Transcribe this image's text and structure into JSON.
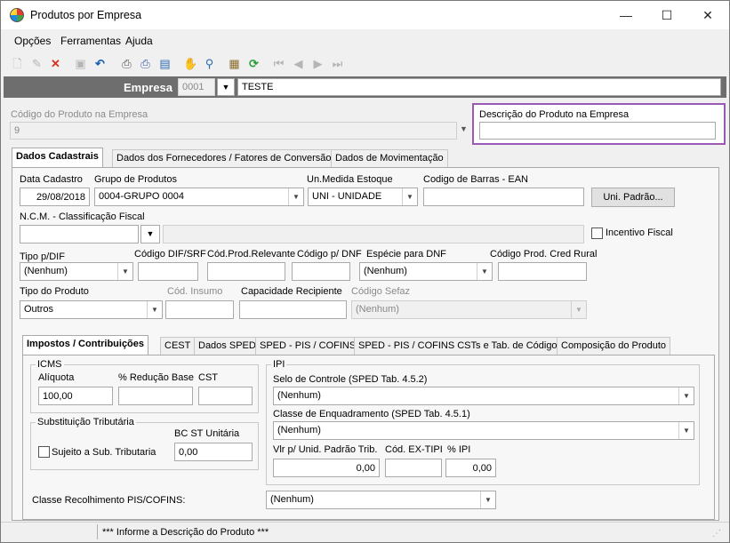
{
  "window": {
    "title": "Produtos por Empresa",
    "minimize": "—",
    "maximize": "☐",
    "close": "✕"
  },
  "menu": [
    "Opções",
    "Ferramentas",
    "Ajuda"
  ],
  "toolbar_icons": [
    "new-icon",
    "edit-icon",
    "delete-icon",
    "save-icon",
    "undo-icon",
    "print-icon",
    "print-preview-icon",
    "export-icon",
    "hand-icon",
    "search-icon",
    "report-icon",
    "refresh-icon",
    "first-record-icon",
    "prev-record-icon",
    "next-record-icon",
    "last-record-icon"
  ],
  "empresa": {
    "label": "Empresa",
    "code": "0001",
    "name": "TESTE"
  },
  "codigo_produto": {
    "label": "Código do Produto na Empresa",
    "value": "9"
  },
  "descricao_produto": {
    "label": "Descrição do Produto na Empresa",
    "value": ""
  },
  "main_tabs": [
    "Dados Cadastrais",
    "Dados dos Fornecedores / Fatores de Conversão",
    "Dados de Movimentação"
  ],
  "cadastro": {
    "data_cadastro_label": "Data Cadastro",
    "data_cadastro": "29/08/2018",
    "grupo_label": "Grupo de Produtos",
    "grupo": "0004-GRUPO 0004",
    "un_medida_label": "Un.Medida Estoque",
    "un_medida": "UNI - UNIDADE",
    "ean_label": "Codigo de Barras - EAN",
    "ean": "",
    "uni_padrao_btn": "Uni. Padrão...",
    "ncm_label": "N.C.M. -  Classificação Fiscal",
    "ncm": "",
    "ncm_desc": "",
    "incentivo_label": "Incentivo Fiscal",
    "tipo_dif_label": "Tipo p/DIF",
    "tipo_dif": "(Nenhum)",
    "cod_dif_srf_label": "Código DIF/SRF",
    "cod_dif_srf": "",
    "cod_prod_relevante_label": "Cód.Prod.Relevante",
    "cod_prod_relevante": "",
    "cod_dnf_label": "Código p/ DNF",
    "cod_dnf": "",
    "especie_dnf_label": "Espécie para DNF",
    "especie_dnf": "(Nenhum)",
    "cod_cred_rural_label": "Código Prod. Cred Rural",
    "cod_cred_rural": "",
    "tipo_produto_label": "Tipo do Produto",
    "tipo_produto": "Outros",
    "cod_insumo_label": "Cód. Insumo",
    "cod_insumo": "",
    "capacidade_label": "Capacidade Recipiente",
    "capacidade": "",
    "cod_sefaz_label": "Código Sefaz",
    "cod_sefaz": "(Nenhum)"
  },
  "sub_tabs": [
    "Impostos / Contribuições",
    "CEST",
    "Dados SPED",
    "SPED - PIS / COFINS",
    "SPED - PIS / COFINS CSTs e Tab. de Códigos",
    "Composição do Produto"
  ],
  "impostos": {
    "icms_title": "ICMS",
    "aliquota_label": "Alíquota",
    "aliquota": "100,00",
    "reducao_label": "% Redução Base",
    "reducao": "",
    "cst_label": "CST",
    "cst": "",
    "subst_title": "Substituição Tributária",
    "bc_st_label": "BC ST Unitária",
    "bc_st": "0,00",
    "sujeito_label": "Sujeito a Sub. Tributaria",
    "ipi_title": "IPI",
    "selo_label": "Selo de Controle (SPED Tab. 4.5.2)",
    "selo": "(Nenhum)",
    "classe_enq_label": "Classe de Enquadramento (SPED Tab. 4.5.1)",
    "classe_enq": "(Nenhum)",
    "vlr_unid_label": "Vlr p/ Unid. Padrão Trib.",
    "vlr_unid": "0,00",
    "cod_ex_tipi_label": "Cód. EX-TIPI",
    "cod_ex_tipi": "",
    "pct_ipi_label": "% IPI",
    "pct_ipi": "0,00",
    "classe_rec_label": "Classe Recolhimento PIS/COFINS:",
    "classe_rec": "(Nenhum)"
  },
  "status": {
    "message": "*** Informe a Descrição do Produto ***"
  }
}
